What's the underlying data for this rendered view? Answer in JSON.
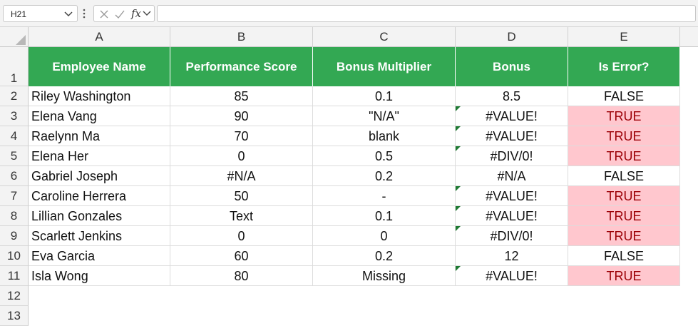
{
  "formula_bar": {
    "name_box": "H21",
    "formula": "",
    "fx_label": "fx"
  },
  "columns": [
    "A",
    "B",
    "C",
    "D",
    "E"
  ],
  "row_numbers": [
    "1",
    "2",
    "3",
    "4",
    "5",
    "6",
    "7",
    "8",
    "9",
    "10",
    "11",
    "12",
    "13"
  ],
  "table": {
    "headers": [
      "Employee Name",
      "Performance Score",
      "Bonus Multiplier",
      "Bonus",
      "Is Error?"
    ],
    "rows": [
      {
        "name": "Riley Washington",
        "score": "85",
        "multiplier": "0.1",
        "bonus": "8.5",
        "is_error": "FALSE",
        "flag": false
      },
      {
        "name": "Elena Vang",
        "score": "90",
        "multiplier": "\"N/A\"",
        "bonus": "#VALUE!",
        "is_error": "TRUE",
        "flag": true
      },
      {
        "name": "Raelynn Ma",
        "score": "70",
        "multiplier": "blank",
        "bonus": "#VALUE!",
        "is_error": "TRUE",
        "flag": true
      },
      {
        "name": "Elena Her",
        "score": "0",
        "multiplier": "0.5",
        "bonus": "#DIV/0!",
        "is_error": "TRUE",
        "flag": true
      },
      {
        "name": "Gabriel Joseph",
        "score": "#N/A",
        "multiplier": "0.2",
        "bonus": "#N/A",
        "is_error": "FALSE",
        "flag": false
      },
      {
        "name": "Caroline Herrera",
        "score": "50",
        "multiplier": "-",
        "bonus": "#VALUE!",
        "is_error": "TRUE",
        "flag": true
      },
      {
        "name": "Lillian Gonzales",
        "score": "Text",
        "multiplier": "0.1",
        "bonus": "#VALUE!",
        "is_error": "TRUE",
        "flag": true
      },
      {
        "name": "Scarlett Jenkins",
        "score": "0",
        "multiplier": "0",
        "bonus": "#DIV/0!",
        "is_error": "TRUE",
        "flag": true
      },
      {
        "name": "Eva Garcia",
        "score": "60",
        "multiplier": "0.2",
        "bonus": "12",
        "is_error": "FALSE",
        "flag": false
      },
      {
        "name": "Isla Wong",
        "score": "80",
        "multiplier": "Missing",
        "bonus": "#VALUE!",
        "is_error": "TRUE",
        "flag": true
      }
    ]
  },
  "colors": {
    "header_fill": "#33a853",
    "error_fill": "#ffc7ce",
    "error_text": "#9c0006",
    "error_indicator": "#1e7a33"
  }
}
